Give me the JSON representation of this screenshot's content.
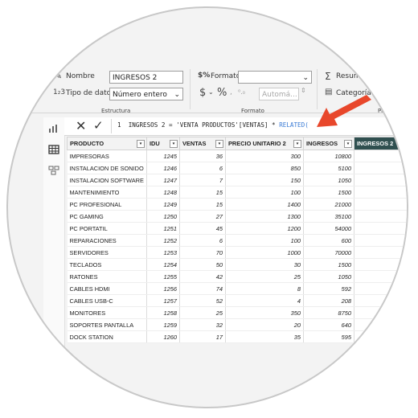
{
  "ribbon": {
    "structure": {
      "name_label": "Nombre",
      "name_value": "INGRESOS 2",
      "datatype_label": "Tipo de datos",
      "datatype_value": "Número entero",
      "group_title": "Estructura"
    },
    "format": {
      "format_label": "Formato",
      "format_value": "",
      "currency_symbol": "$",
      "percent_symbol": "%",
      "auto_value": "Automá...",
      "group_title": "Formato"
    },
    "properties": {
      "summary_label": "Resumen",
      "category_label": "Categoría de da",
      "group_title": "Prop"
    }
  },
  "formula_bar": {
    "line_number": "1",
    "expression_prefix": "INGRESOS 2 = 'VENTA PRODUCTOS'[VENTAS] * ",
    "expression_function": "RELATED("
  },
  "table": {
    "columns": [
      "PRODUCTO",
      "IDU",
      "VENTAS",
      "PRECIO UNITARIO 2",
      "INGRESOS",
      "INGRESOS 2"
    ],
    "rows": [
      [
        "IMPRESORAS",
        "1245",
        "36",
        "300",
        "10800",
        ""
      ],
      [
        "INSTALACION DE SONIDO",
        "1246",
        "6",
        "850",
        "5100",
        ""
      ],
      [
        "INSTALACION SOFTWARE",
        "1247",
        "7",
        "150",
        "1050",
        ""
      ],
      [
        "MANTENIMIENTO",
        "1248",
        "15",
        "100",
        "1500",
        ""
      ],
      [
        "PC PROFESIONAL",
        "1249",
        "15",
        "1400",
        "21000",
        ""
      ],
      [
        "PC GAMING",
        "1250",
        "27",
        "1300",
        "35100",
        ""
      ],
      [
        "PC PORTATIL",
        "1251",
        "45",
        "1200",
        "54000",
        ""
      ],
      [
        "REPARACIONES",
        "1252",
        "6",
        "100",
        "600",
        ""
      ],
      [
        "SERVIDORES",
        "1253",
        "70",
        "1000",
        "70000",
        ""
      ],
      [
        "TECLADOS",
        "1254",
        "50",
        "30",
        "1500",
        ""
      ],
      [
        "RATONES",
        "1255",
        "42",
        "25",
        "1050",
        ""
      ],
      [
        "CABLES HDMI",
        "1256",
        "74",
        "8",
        "592",
        ""
      ],
      [
        "CABLES USB-C",
        "1257",
        "52",
        "4",
        "208",
        ""
      ],
      [
        "MONITORES",
        "1258",
        "25",
        "350",
        "8750",
        ""
      ],
      [
        "SOPORTES PANTALLA",
        "1259",
        "32",
        "20",
        "640",
        ""
      ],
      [
        "DOCK STATION",
        "1260",
        "17",
        "35",
        "595",
        ""
      ]
    ]
  },
  "colors": {
    "selected_header": "#2f4f4f",
    "arrow": "#e8472b",
    "function_text": "#3a7bd5"
  }
}
